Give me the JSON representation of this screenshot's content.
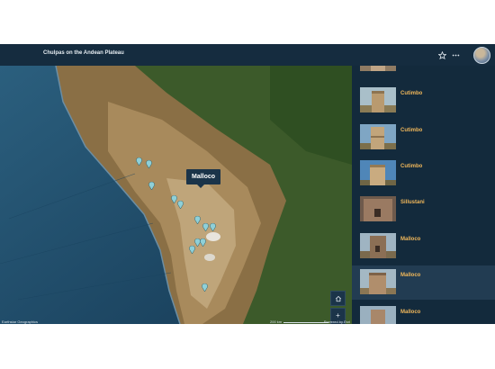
{
  "header": {
    "title": "Chulpas on the Andean Plateau",
    "favorite_icon": "star-icon",
    "more_icon": "more-icon",
    "avatar_icon": "user-avatar"
  },
  "map": {
    "tooltip": "Malloco",
    "controls": {
      "home_icon": "home-icon",
      "zoom_in": "+",
      "zoom_out": "−"
    },
    "attribution_left": "Earthstar Geographics",
    "scale_label": "200 km",
    "attribution_right": "Powered by Esri",
    "pin_color": "#8fd0d8"
  },
  "cards": [
    {
      "label": ""
    },
    {
      "label": "Cutimbo"
    },
    {
      "label": "Cutimbo"
    },
    {
      "label": "Cutimbo"
    },
    {
      "label": "Sillustani"
    },
    {
      "label": "Malloco"
    },
    {
      "label": "Malloco"
    },
    {
      "label": "Malloco"
    }
  ],
  "colors": {
    "accent": "#f0b75a",
    "header_bg": "#152c3f",
    "panel_bg": "#132a3c"
  }
}
